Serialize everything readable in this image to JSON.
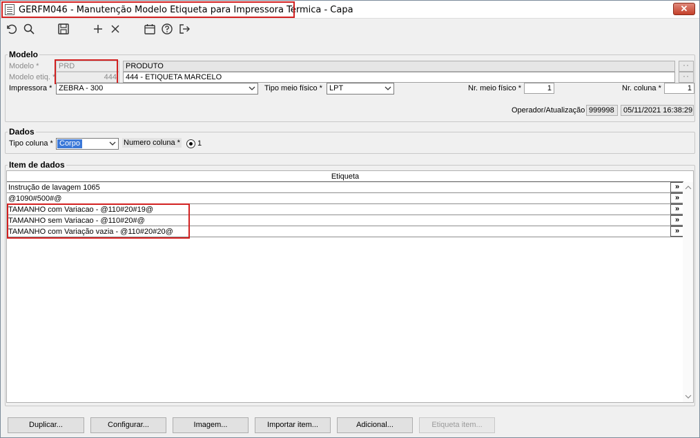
{
  "window": {
    "title": "GERFM046 - Manutenção Modelo Etiqueta para Impressora Térmica - Capa",
    "close_label": "✕"
  },
  "toolbar": {
    "icons": [
      "undo-icon",
      "search-icon",
      "save-icon",
      "add-icon",
      "delete-icon",
      "calendar-icon",
      "help-icon",
      "exit-icon"
    ]
  },
  "modelo": {
    "legend": "Modelo",
    "modelo_label": "Modelo *",
    "modelo_code": "PRD",
    "modelo_desc": "PRODUTO",
    "modelo_etiq_label": "Modelo etiq. *",
    "modelo_etiq_code": "444",
    "modelo_etiq_desc": "444 - ETIQUETA MARCELO",
    "impressora_label": "Impressora *",
    "impressora_value": "ZEBRA - 300",
    "tipo_meio_label": "Tipo meio físico *",
    "tipo_meio_value": "LPT",
    "nr_meio_label": "Nr. meio físico *",
    "nr_meio_value": "1",
    "nr_coluna_label": "Nr. coluna *",
    "nr_coluna_value": "1",
    "operador_label": "Operador/Atualização",
    "operador_value": "999998",
    "atualizacao_value": "05/11/2021 16:38:29"
  },
  "dados": {
    "legend": "Dados",
    "tipo_coluna_label": "Tipo coluna *",
    "tipo_coluna_value": "Corpo",
    "numero_coluna_label": "Numero coluna *",
    "numero_coluna_value": "1"
  },
  "itens": {
    "legend": "Item de dados",
    "column_header": "Etiqueta",
    "row_button_label": "»",
    "rows": [
      "Instrução de lavagem 1065",
      "@1090#500#@",
      "TAMANHO com Variacao - @110#20#19@",
      "TAMANHO sem Variacao - @110#20#@",
      "TAMANHO com Variação vazia - @110#20#20@"
    ]
  },
  "buttons": {
    "duplicar": "Duplicar...",
    "configurar": "Configurar...",
    "imagem": "Imagem...",
    "importar": "Importar item...",
    "adicional": "Adicional...",
    "etiqueta_item": "Etiqueta item..."
  }
}
